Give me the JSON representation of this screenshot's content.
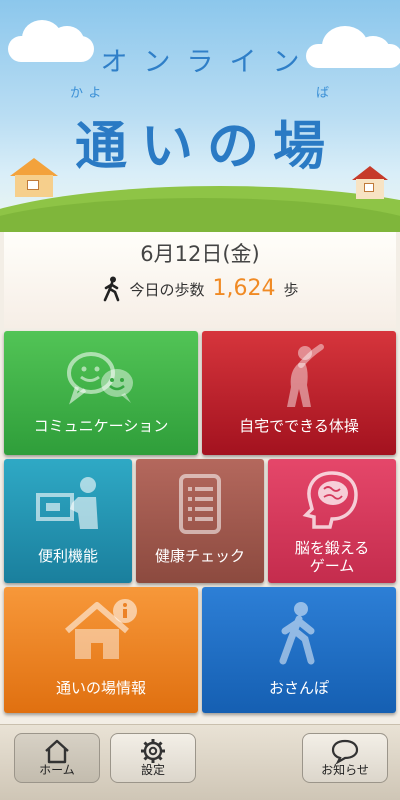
{
  "header": {
    "subtitle": "オンライン",
    "ruby_left": "かよ",
    "ruby_right": "ば",
    "title": "通いの場"
  },
  "date_panel": {
    "date": "6月12日(金)",
    "steps_label": "今日の歩数",
    "steps_value": "1,624",
    "steps_unit": "歩",
    "steps_icon": "walking-person-icon",
    "accent_color": "#f08a24"
  },
  "tiles": [
    {
      "label": "コミュニケーション",
      "icon": "chat-bubbles-icon",
      "color": "#3aab45"
    },
    {
      "label": "自宅でできる体操",
      "icon": "stretching-person-icon",
      "color": "#b8202b"
    },
    {
      "label": "便利機能",
      "icon": "delivery-person-icon",
      "color": "#2393b1"
    },
    {
      "label": "健康チェック",
      "icon": "checklist-document-icon",
      "color": "#9e584d"
    },
    {
      "label1": "脳を鍛える",
      "label2": "ゲーム",
      "icon": "brain-head-icon",
      "color": "#d53a5c"
    },
    {
      "label": "通いの場情報",
      "icon": "house-info-icon",
      "color": "#ec8226"
    },
    {
      "label": "おさんぽ",
      "icon": "walking-person-icon",
      "color": "#1f6fc4"
    }
  ],
  "bottom_nav": [
    {
      "label": "ホーム",
      "icon": "home-icon",
      "active": true
    },
    {
      "label": "設定",
      "icon": "gear-icon",
      "active": false
    },
    {
      "label": "お知らせ",
      "icon": "speech-bubble-icon",
      "active": false
    }
  ]
}
